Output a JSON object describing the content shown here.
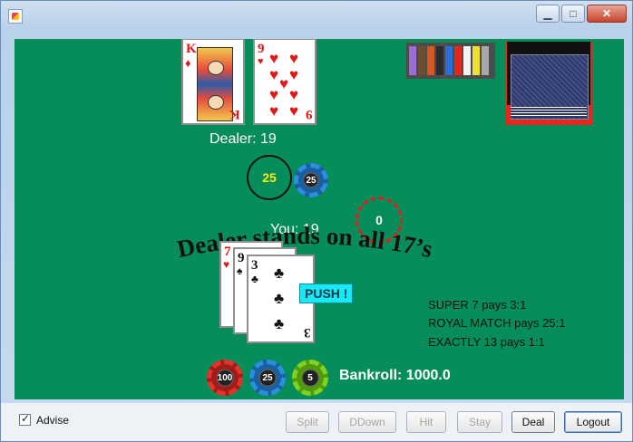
{
  "window": {
    "title": "",
    "controls": {
      "minimize": "▁",
      "maximize": "□",
      "close": "✕"
    }
  },
  "dealer": {
    "label": "Dealer: 19",
    "cards": [
      {
        "rank": "K",
        "suit": "♦"
      },
      {
        "rank": "9",
        "suit": "♥"
      }
    ]
  },
  "player": {
    "label": "You: 19",
    "cards": [
      {
        "rank": "7",
        "suit": "♥"
      },
      {
        "rank": "9",
        "suit": "♠"
      },
      {
        "rank": "3",
        "suit": "♣"
      }
    ]
  },
  "bet": {
    "main_circle_value": "25",
    "main_chip": "25",
    "side_bet_value": "0"
  },
  "banner": "Dealer stands on all 17’s",
  "result_badge": "PUSH !",
  "side_bets": [
    "SUPER 7 pays 3:1",
    "ROYAL MATCH pays 25:1",
    "EXACTLY 13 pays 1:1"
  ],
  "chips": [
    {
      "value": "100",
      "color": "#e5322d"
    },
    {
      "value": "25",
      "color": "#2a8fe0"
    },
    {
      "value": "5",
      "color": "#7ed321"
    }
  ],
  "bankroll": "Bankroll: 1000.0",
  "advise": {
    "label": "Advise",
    "checked": true
  },
  "buttons": {
    "split": "Split",
    "ddown": "DDown",
    "hit": "Hit",
    "stay": "Stay",
    "deal": "Deal",
    "logout": "Logout"
  },
  "colors": {
    "table": "#078d5a",
    "badge": "#19e9f5",
    "bet_text": "#f6ec18",
    "side_bet_ring": "#d9221d"
  }
}
